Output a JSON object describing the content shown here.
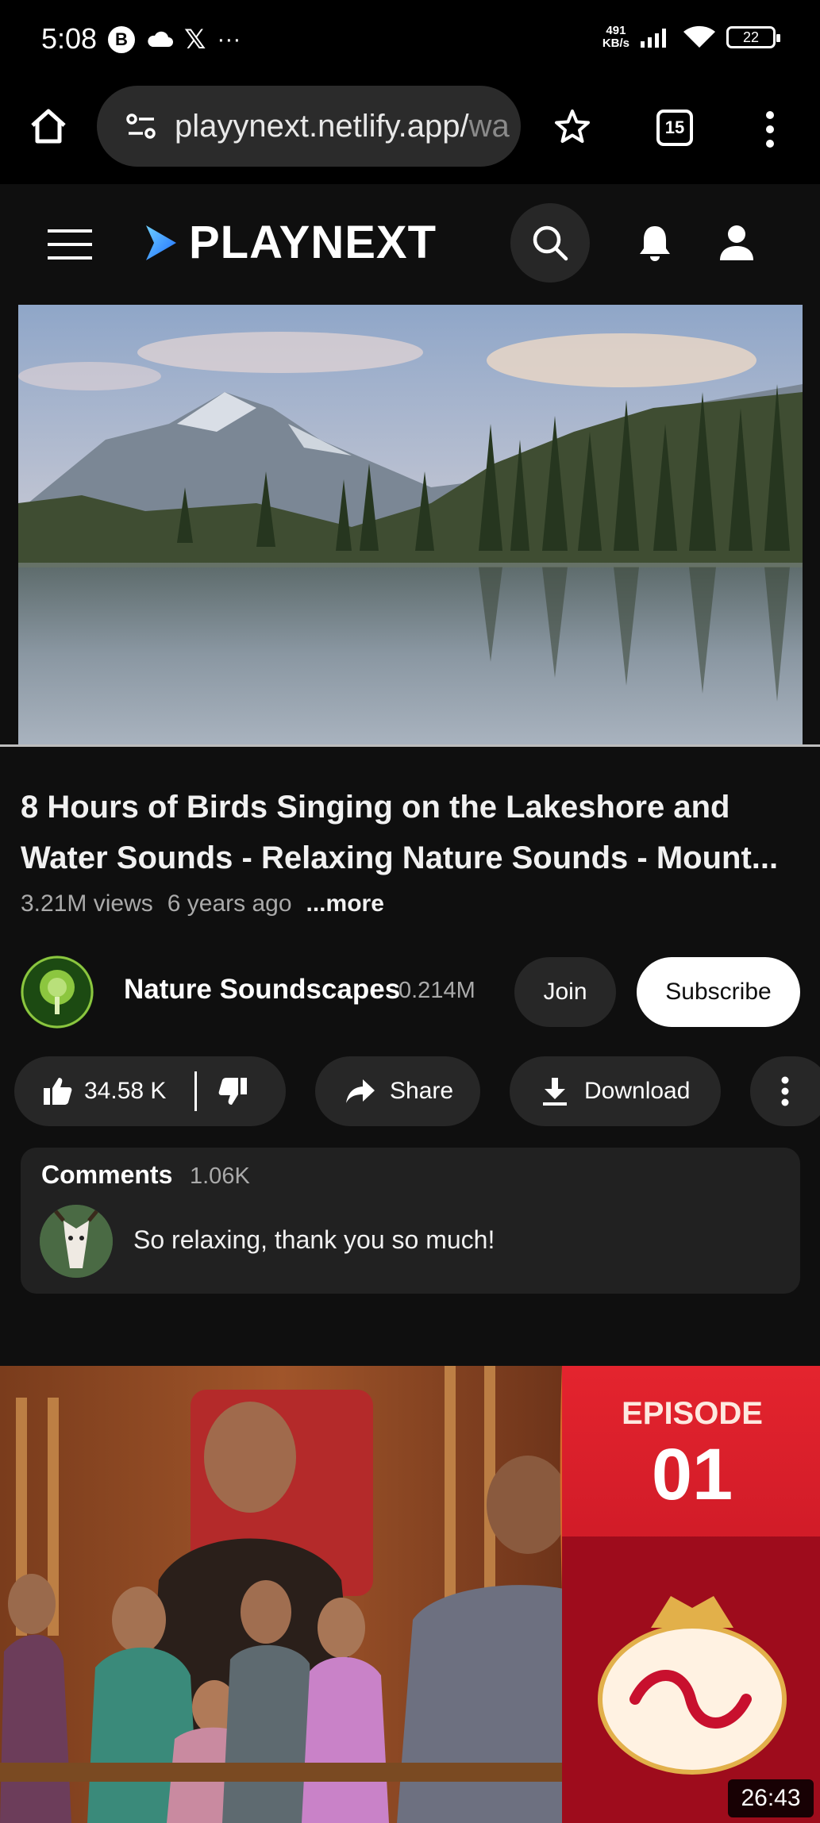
{
  "status_bar": {
    "time": "5:08",
    "b_icon": "B",
    "x_icon": "𝕏",
    "more": "···",
    "net_speed_value": "491",
    "net_speed_unit": "KB/s",
    "battery": "22"
  },
  "browser": {
    "url": "playynext.netlify.app/",
    "url_faded": "wa",
    "tab_count": "15"
  },
  "header": {
    "logo_text": "PLAYNEXT"
  },
  "video": {
    "title": "8 Hours of Birds Singing on the Lakeshore and Water Sounds - Relaxing Nature Sounds - Mount...",
    "views": "3.21M views",
    "age": "6 years ago",
    "more_label": "...more"
  },
  "channel": {
    "name": "Nature Soundscapes",
    "subscribers": "0.214M",
    "join_label": "Join",
    "subscribe_label": "Subscribe"
  },
  "actions": {
    "like_count": "34.58 K",
    "share_label": "Share",
    "download_label": "Download"
  },
  "comments": {
    "title": "Comments",
    "count": "1.06K",
    "top_comment": "So relaxing, thank you so much!"
  },
  "next_video": {
    "episode_label": "EPISODE",
    "episode_number": "01",
    "duration": "26:43"
  },
  "colors": {
    "background": "#0f0f0f",
    "pill": "#272727",
    "logo_accent": "#3ea6ff",
    "next_thumb_red": "#c8102e"
  },
  "icons": [
    "home-icon",
    "site-settings-icon",
    "star-icon",
    "tabs-icon",
    "kebab-icon",
    "hamburger-icon",
    "play-logo-icon",
    "search-icon",
    "bell-icon",
    "account-icon",
    "thumbs-up-icon",
    "thumbs-down-icon",
    "share-icon",
    "download-icon",
    "more-icon"
  ]
}
